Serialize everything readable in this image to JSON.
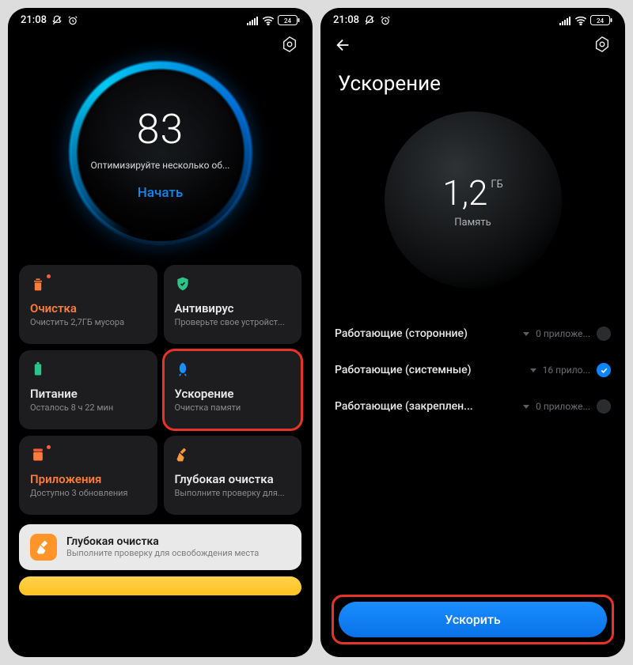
{
  "status": {
    "time": "21:08",
    "battery": "24"
  },
  "phone1": {
    "score": "83",
    "scoreHint": "Оптимизируйте несколько об...",
    "scoreAction": "Начать",
    "tiles": [
      {
        "name": "cleanup",
        "title": "Очистка",
        "sub": "Очистить 2,7ГБ мусора",
        "tone": "orange",
        "iconColor": "#ff7b3a",
        "badge": true
      },
      {
        "name": "antivirus",
        "title": "Антивирус",
        "sub": "Проверьте свое устройст...",
        "tone": "white",
        "iconColor": "#2bc48a",
        "badge": false
      },
      {
        "name": "power",
        "title": "Питание",
        "sub": "Осталось 8 ч 22 мин",
        "tone": "white",
        "iconColor": "#2bc48a",
        "badge": false
      },
      {
        "name": "boost",
        "title": "Ускорение",
        "sub": "Очистка памяти",
        "tone": "white",
        "iconColor": "#1a8dff",
        "badge": false,
        "highlight": true
      },
      {
        "name": "apps",
        "title": "Приложения",
        "sub": "Доступно 3 обновления",
        "tone": "orange",
        "iconColor": "#ff7b3a",
        "badge": true
      },
      {
        "name": "deepclean",
        "title": "Глубокая очистка",
        "sub": "Выполните проверку для...",
        "tone": "white",
        "iconColor": "#ff9a3a",
        "badge": false
      }
    ],
    "bottom": {
      "title": "Глубокая очистка",
      "sub": "Выполните проверку для освобождения места"
    }
  },
  "phone2": {
    "title": "Ускорение",
    "memValue": "1,2",
    "memUnit": "ГБ",
    "memLabel": "Память",
    "rows": [
      {
        "name": "third-party",
        "label": "Работающие (сторонние)",
        "value": "0 приложе...",
        "checked": false
      },
      {
        "name": "system",
        "label": "Работающие (системные)",
        "value": "16 прило...",
        "checked": true
      },
      {
        "name": "pinned",
        "label": "Работающие (закреплен...",
        "value": "0 приложе...",
        "checked": false
      }
    ],
    "cta": "Ускорить"
  }
}
